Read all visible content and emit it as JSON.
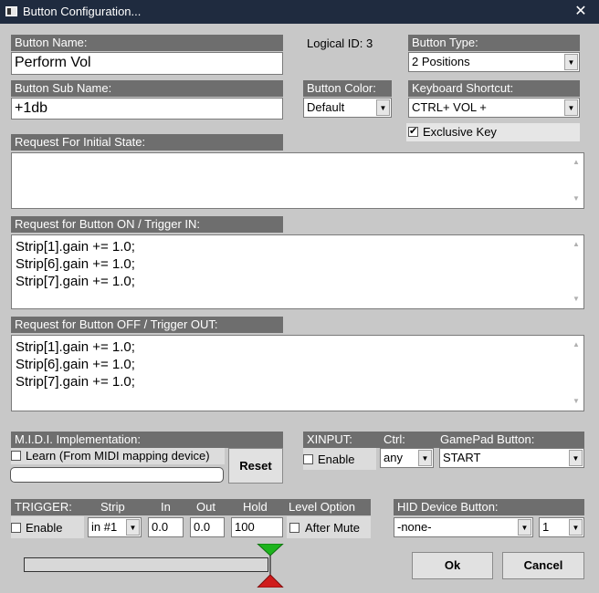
{
  "window": {
    "title": "Button Configuration...",
    "close_glyph": "✕"
  },
  "button_name": {
    "label": "Button Name:",
    "value": "Perform Vol"
  },
  "logical_id": "Logical ID: 3",
  "button_type": {
    "label": "Button Type:",
    "value": "2 Positions"
  },
  "button_sub_name": {
    "label": "Button Sub Name:",
    "value": "+1db"
  },
  "button_color": {
    "label": "Button Color:",
    "value": "Default"
  },
  "keyboard_shortcut": {
    "label": "Keyboard Shortcut:",
    "value": "CTRL+ VOL +"
  },
  "exclusive_key": {
    "label": "Exclusive Key",
    "checked": true
  },
  "request_initial": {
    "label": "Request For Initial State:",
    "text": ""
  },
  "request_on": {
    "label": "Request for Button ON / Trigger IN:",
    "text": "Strip[1].gain += 1.0;\nStrip[6].gain += 1.0;\nStrip[7].gain += 1.0;"
  },
  "request_off": {
    "label": "Request for Button OFF / Trigger OUT:",
    "text": "Strip[1].gain += 1.0;\nStrip[6].gain += 1.0;\nStrip[7].gain += 1.0;"
  },
  "midi": {
    "label": "M.I.D.I. Implementation:",
    "learn_label": "Learn (From MIDI mapping device)",
    "learn_checked": false,
    "reset_label": "Reset"
  },
  "xinput": {
    "label": "XINPUT:",
    "ctrl_label": "Ctrl:",
    "gamepad_label": "GamePad Button:",
    "enable_label": "Enable",
    "enable_checked": false,
    "ctrl_value": "any",
    "gamepad_value": "START"
  },
  "trigger": {
    "label": "TRIGGER:",
    "strip_label": "Strip",
    "in_label": "In",
    "out_label": "Out",
    "hold_label": "Hold",
    "level_option_label": "Level Option",
    "enable_label": "Enable",
    "enable_checked": false,
    "strip_value": "in #1",
    "in_value": "0.0",
    "out_value": "0.0",
    "hold_value": "100",
    "after_mute_label": "After Mute",
    "after_mute_checked": false
  },
  "hid": {
    "label": "HID Device Button:",
    "device_value": "-none-",
    "index_value": "1"
  },
  "actions": {
    "ok_label": "Ok",
    "cancel_label": "Cancel"
  },
  "icons": {
    "dropdown": "▼",
    "scroll_up": "▲",
    "scroll_down": "▼",
    "marker_up_color": "#1db41d",
    "marker_down_color": "#d01c1c"
  }
}
